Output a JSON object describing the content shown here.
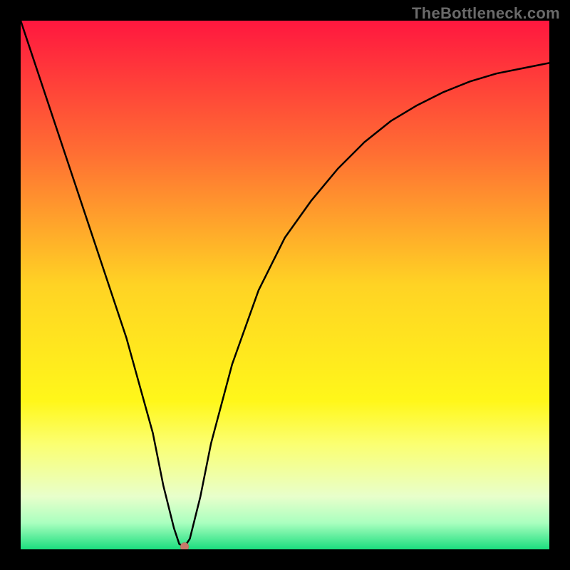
{
  "watermark": "TheBottleneck.com",
  "chart_data": {
    "type": "line",
    "title": "",
    "xlabel": "",
    "ylabel": "",
    "xlim": [
      0,
      100
    ],
    "ylim": [
      0,
      100
    ],
    "grid": false,
    "legend": false,
    "gradient_stops": [
      {
        "offset": 0,
        "color": "#ff173f"
      },
      {
        "offset": 0.25,
        "color": "#ff6e33"
      },
      {
        "offset": 0.5,
        "color": "#ffd324"
      },
      {
        "offset": 0.72,
        "color": "#fff71a"
      },
      {
        "offset": 0.8,
        "color": "#fbff70"
      },
      {
        "offset": 0.9,
        "color": "#e8ffcb"
      },
      {
        "offset": 0.95,
        "color": "#aaffbf"
      },
      {
        "offset": 1.0,
        "color": "#1bde7e"
      }
    ],
    "series": [
      {
        "name": "bottleneck-curve",
        "x": [
          0,
          5,
          10,
          15,
          20,
          25,
          27,
          29,
          30,
          31,
          32,
          34,
          36,
          40,
          45,
          50,
          55,
          60,
          65,
          70,
          75,
          80,
          85,
          90,
          95,
          100
        ],
        "y": [
          100,
          85,
          70,
          55,
          40,
          22,
          12,
          4,
          1,
          0.5,
          2,
          10,
          20,
          35,
          49,
          59,
          66,
          72,
          77,
          81,
          84,
          86.5,
          88.5,
          90,
          91,
          92
        ]
      }
    ],
    "marker": {
      "x": 31,
      "y": 0.5,
      "color": "#c77a6a"
    }
  }
}
